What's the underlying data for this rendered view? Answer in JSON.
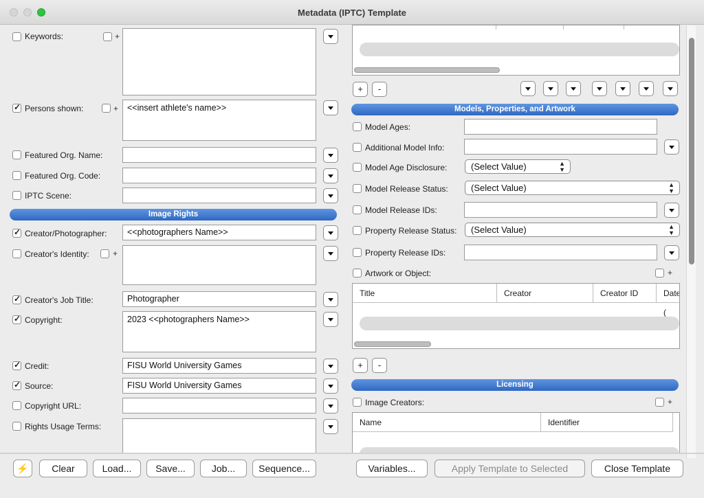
{
  "window": {
    "title": "Metadata (IPTC) Template"
  },
  "left": {
    "keywords": {
      "label": "Keywords:",
      "value": ""
    },
    "persons_shown": {
      "label": "Persons shown:",
      "value": "<<insert athlete's name>>"
    },
    "featured_org_name": {
      "label": "Featured Org. Name:",
      "value": ""
    },
    "featured_org_code": {
      "label": "Featured Org. Code:",
      "value": ""
    },
    "iptc_scene": {
      "label": "IPTC Scene:",
      "value": ""
    },
    "image_rights_header": "Image Rights",
    "creator_photographer": {
      "label": "Creator/Photographer:",
      "value": "<<photographers Name>>"
    },
    "creator_identity": {
      "label": "Creator's Identity:",
      "value": ""
    },
    "creator_job_title": {
      "label": "Creator's Job Title:",
      "value": "Photographer"
    },
    "copyright": {
      "label": "Copyright:",
      "value": "2023 <<photographers Name>>"
    },
    "credit": {
      "label": "Credit:",
      "value": "FISU World University Games"
    },
    "source": {
      "label": "Source:",
      "value": "FISU World University Games"
    },
    "copyright_url": {
      "label": "Copyright URL:",
      "value": ""
    },
    "rights_usage_terms": {
      "label": "Rights Usage Terms:",
      "value": ""
    },
    "plus": "+"
  },
  "right": {
    "top_add": "+",
    "top_remove": "-",
    "models_header": "Models, Properties, and Artwork",
    "model_ages": {
      "label": "Model Ages:",
      "value": ""
    },
    "additional_model_info": {
      "label": "Additional Model Info:",
      "value": ""
    },
    "model_age_disclosure": {
      "label": "Model Age Disclosure:",
      "value": "(Select Value)"
    },
    "model_release_status": {
      "label": "Model Release Status:",
      "value": "(Select Value)"
    },
    "model_release_ids": {
      "label": "Model Release IDs:",
      "value": ""
    },
    "property_release_status": {
      "label": "Property Release Status:",
      "value": "(Select Value)"
    },
    "property_release_ids": {
      "label": "Property Release IDs:",
      "value": ""
    },
    "artwork_or_object": {
      "label": "Artwork or Object:"
    },
    "artwork_columns": [
      "Title",
      "Creator",
      "Creator ID",
      "Date ("
    ],
    "artwork_add": "+",
    "artwork_remove": "-",
    "licensing_header": "Licensing",
    "image_creators": {
      "label": "Image Creators:"
    },
    "image_creators_columns": [
      "Name",
      "Identifier"
    ],
    "plus": "+"
  },
  "footer": {
    "lightning": "⚡",
    "clear": "Clear",
    "load": "Load...",
    "save": "Save...",
    "job": "Job...",
    "sequence": "Sequence...",
    "variables": "Variables...",
    "apply": "Apply Template to Selected",
    "close": "Close Template"
  }
}
